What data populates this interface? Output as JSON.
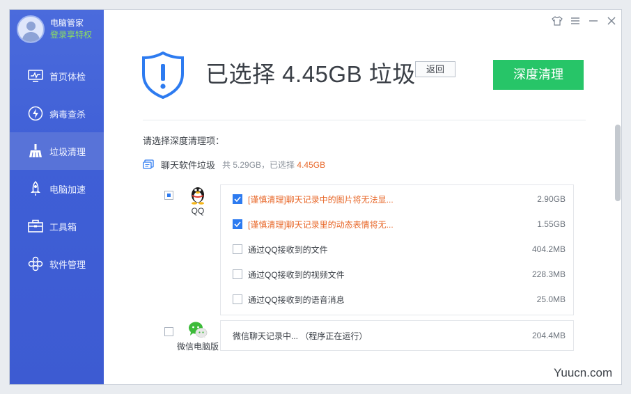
{
  "sidebar": {
    "profile_name": "电脑管家",
    "profile_vip": "登录享特权",
    "items": [
      {
        "label": "首页体检",
        "icon": "monitor-icon"
      },
      {
        "label": "病毒查杀",
        "icon": "lightning-icon"
      },
      {
        "label": "垃圾清理",
        "icon": "broom-icon",
        "active": true
      },
      {
        "label": "电脑加速",
        "icon": "rocket-icon"
      },
      {
        "label": "工具箱",
        "icon": "toolbox-icon"
      },
      {
        "label": "软件管理",
        "icon": "software-icon"
      }
    ]
  },
  "header": {
    "title": "已选择 4.45GB 垃圾",
    "back_label": "返回",
    "deep_clean_label": "深度清理"
  },
  "prompt": "请选择深度清理项：",
  "category": {
    "name": "聊天软件垃圾",
    "summary_prefix": "共 5.29GB，已选择 ",
    "selected": "4.45GB"
  },
  "apps": [
    {
      "name": "QQ",
      "icon": "qq-penguin-icon",
      "items": [
        {
          "label": "[谨慎清理]聊天记录中的图片将无法显...",
          "size": "2.90GB",
          "checked": true,
          "warn": true
        },
        {
          "label": "[谨慎清理]聊天记录里的动态表情将无...",
          "size": "1.55GB",
          "checked": true,
          "warn": true
        },
        {
          "label": "通过QQ接收到的文件",
          "size": "404.2MB",
          "checked": false,
          "warn": false
        },
        {
          "label": "通过QQ接收到的视频文件",
          "size": "228.3MB",
          "checked": false,
          "warn": false
        },
        {
          "label": "通过QQ接收到的语音消息",
          "size": "25.0MB",
          "checked": false,
          "warn": false
        }
      ]
    },
    {
      "name": "微信电脑版",
      "icon": "wechat-icon",
      "items": [
        {
          "label": "微信聊天记录中... （程序正在运行）",
          "size": "204.4MB",
          "checked": false,
          "warn": false
        }
      ]
    }
  ],
  "watermark": "Yuucn.com",
  "colors": {
    "sidebar": "#3f5fd6",
    "accent_green": "#27c568",
    "warn_orange": "#e8682a",
    "check_blue": "#2d7bf0"
  }
}
